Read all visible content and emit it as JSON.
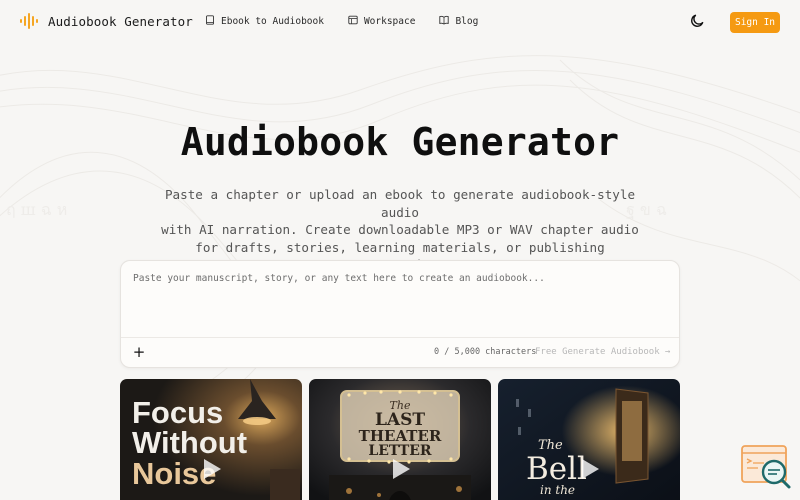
{
  "header": {
    "brand_name": "Audiobook Generator",
    "nav": [
      {
        "label": "Ebook to Audiobook",
        "icon": "book-icon"
      },
      {
        "label": "Workspace",
        "icon": "workspace-icon"
      },
      {
        "label": "Blog",
        "icon": "open-book-icon"
      }
    ],
    "theme_icon": "moon-icon",
    "signin_label": "Sign In"
  },
  "hero": {
    "title": "Audiobook Generator",
    "subtitle_lines": [
      "Paste a chapter or upload an ebook to generate audiobook-style audio",
      "with AI narration. Create downloadable MP3 or WAV chapter audio",
      "for drafts, stories, learning materials, or publishing preparation."
    ]
  },
  "composer": {
    "placeholder": "Paste your manuscript, story, or any text here to create an audiobook...",
    "value": "",
    "add_icon": "plus-icon",
    "char_count": "0 / 5,000 characters",
    "generate_label": "Free Generate Audiobook →"
  },
  "books": [
    {
      "cover_lines": [
        "Focus",
        "Without",
        "Noise"
      ],
      "play_icon": "play-icon"
    },
    {
      "cover_lines": [
        "The",
        "LAST",
        "THEATER",
        "LETTER"
      ],
      "play_icon": "play-icon"
    },
    {
      "cover_lines": [
        "The",
        "Bell",
        "in the"
      ],
      "play_icon": "play-icon"
    }
  ],
  "widget": {
    "icon": "search-chat-icon"
  },
  "colors": {
    "accent": "#f59a12",
    "background": "#f7f6f4",
    "brand_logo": "#f5a623"
  }
}
